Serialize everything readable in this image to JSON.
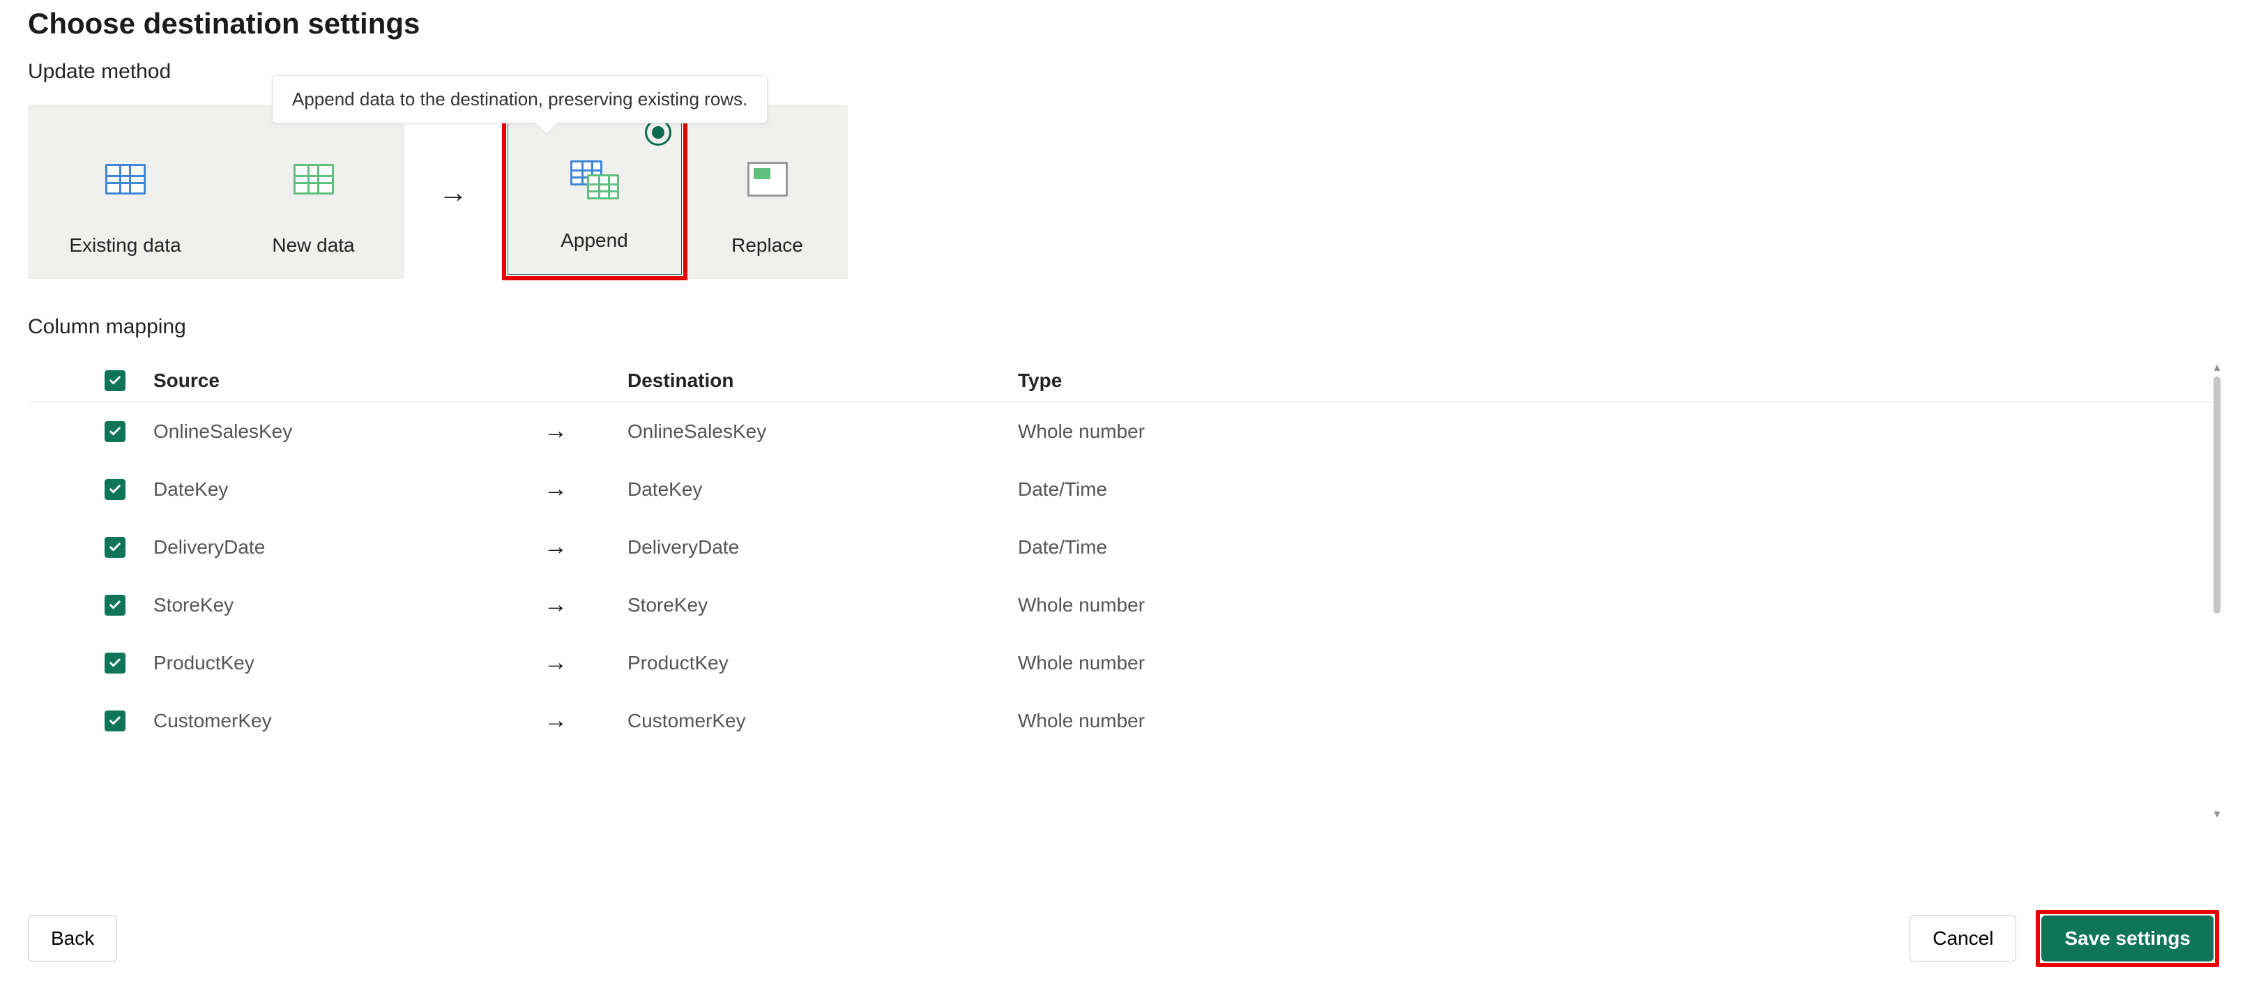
{
  "title": "Choose destination settings",
  "update": {
    "section_title": "Update method",
    "existing_label": "Existing data",
    "new_label": "New data",
    "append_label": "Append",
    "replace_label": "Replace",
    "tooltip": "Append data to the destination, preserving existing rows."
  },
  "mapping": {
    "section_title": "Column mapping",
    "headers": {
      "source": "Source",
      "destination": "Destination",
      "type": "Type"
    },
    "rows": [
      {
        "source": "OnlineSalesKey",
        "destination": "OnlineSalesKey",
        "type": "Whole number"
      },
      {
        "source": "DateKey",
        "destination": "DateKey",
        "type": "Date/Time"
      },
      {
        "source": "DeliveryDate",
        "destination": "DeliveryDate",
        "type": "Date/Time"
      },
      {
        "source": "StoreKey",
        "destination": "StoreKey",
        "type": "Whole number"
      },
      {
        "source": "ProductKey",
        "destination": "ProductKey",
        "type": "Whole number"
      },
      {
        "source": "CustomerKey",
        "destination": "CustomerKey",
        "type": "Whole number"
      }
    ]
  },
  "footer": {
    "back": "Back",
    "cancel": "Cancel",
    "save": "Save settings"
  },
  "glyphs": {
    "arrow_right": "→"
  }
}
